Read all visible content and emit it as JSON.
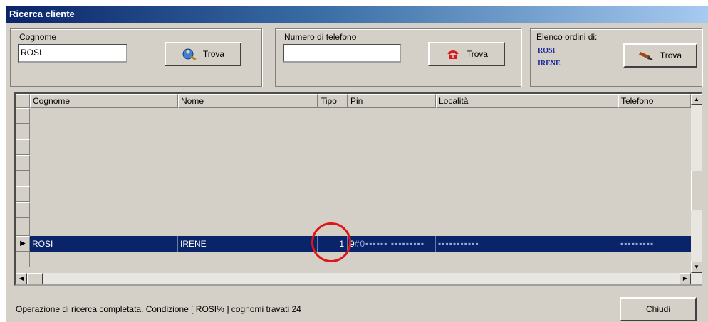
{
  "window": {
    "title": "Ricerca cliente"
  },
  "search_surname": {
    "label": "Cognome",
    "value": "ROSI",
    "button_label": "Trova",
    "icon": "person-search-icon"
  },
  "search_phone": {
    "label": "Numero di telefono",
    "value": "",
    "button_label": "Trova",
    "icon": "telephone-icon"
  },
  "orders": {
    "label": "Elenco ordini di:",
    "surname": "ROSI",
    "name": "IRENE",
    "button_label": "Trova",
    "icon": "pen-icon"
  },
  "table": {
    "columns": [
      "Cognome",
      "Nome",
      "Tipo",
      "Pin",
      "Località",
      "Telefono"
    ],
    "selected_row": {
      "cognome": "ROSI",
      "nome": "IRENE",
      "tipo": "1",
      "pin": "9",
      "localita_masked": "#0▪▪▪▪▪▪ ▪▪▪▪▪▪▪▪▪",
      "telefono_masked": "▪▪▪▪▪▪▪▪▪"
    }
  },
  "status_text": "Operazione di ricerca completata. Condizione [ ROSI% ] cognomi travati  24",
  "close_button_label": "Chiudi",
  "colors": {
    "title_bar": "#0a246a",
    "selection": "#0a246a",
    "annotation_circle": "#e01515"
  }
}
